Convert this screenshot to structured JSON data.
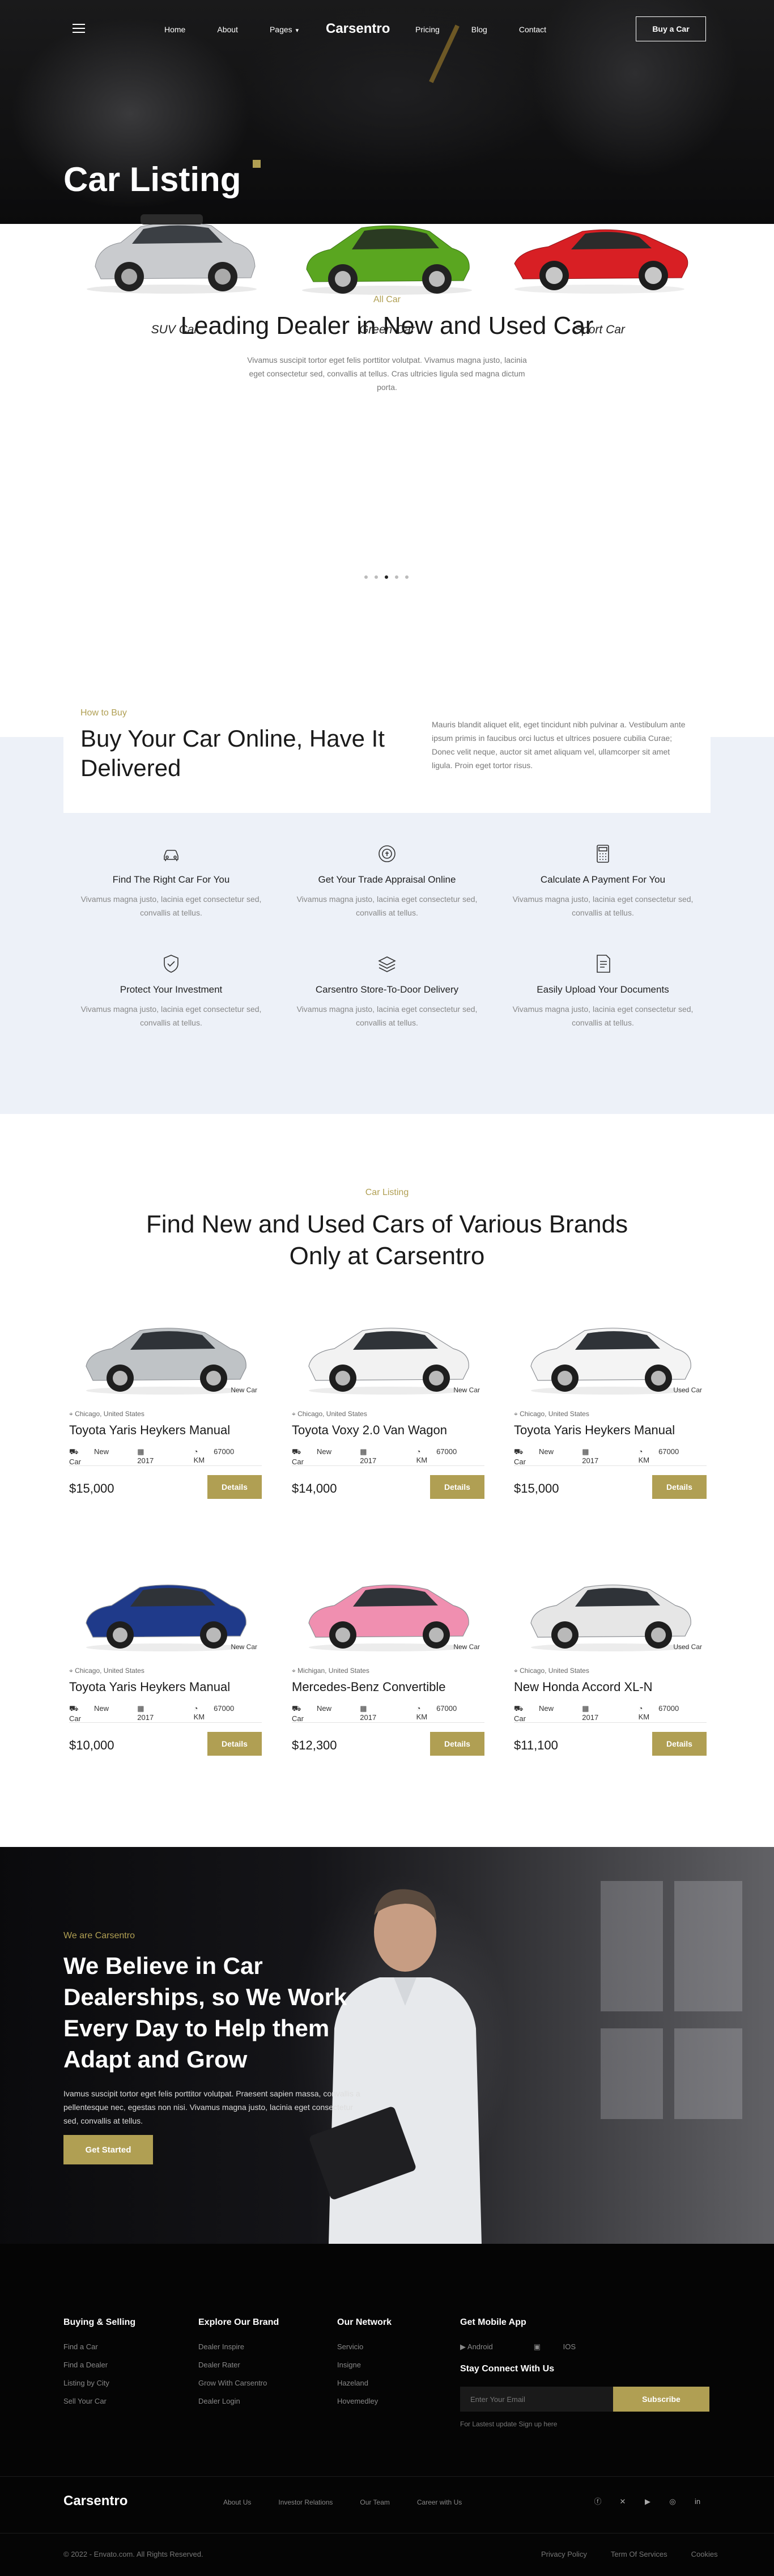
{
  "nav": {
    "items_left": [
      "Home",
      "About",
      "Pages"
    ],
    "logo": "Carsentro",
    "items_right": [
      "Pricing",
      "Blog",
      "Contact"
    ],
    "cta": "Buy a Car"
  },
  "hero": {
    "title": "Car Listing"
  },
  "lead": {
    "kicker": "All Car",
    "title": "Leading Dealer in New and Used Car",
    "subtitle": "Vivamus suscipit tortor eget felis porttitor volutpat. Vivamus magna justo, lacinia eget consectetur sed, convallis at tellus. Cras ultricies ligula sed magna dictum porta.",
    "categories": [
      "SUV Car",
      "Green Car",
      "Sport Car"
    ]
  },
  "how": {
    "kicker": "How to Buy",
    "title": "Buy Your Car Online, Have It Delivered",
    "text": "Mauris blandit aliquet elit, eget tincidunt nibh pulvinar a. Vestibulum ante ipsum primis in faucibus orci luctus et ultrices posuere cubilia Curae; Donec velit neque, auctor sit amet aliquam vel, ullamcorper sit amet ligula. Proin eget tortor risus.",
    "features": [
      {
        "title": "Find The Right Car For You",
        "text": "Vivamus magna justo, lacinia eget consectetur sed, convallis at tellus.",
        "icon": "car-icon"
      },
      {
        "title": "Get Your Trade Appraisal Online",
        "text": "Vivamus magna justo, lacinia eget consectetur sed, convallis at tellus.",
        "icon": "appraisal-icon"
      },
      {
        "title": "Calculate A Payment For You",
        "text": "Vivamus magna justo, lacinia eget consectetur sed, convallis at tellus.",
        "icon": "calculator-icon"
      },
      {
        "title": "Protect Your Investment",
        "text": "Vivamus magna justo, lacinia eget consectetur sed, convallis at tellus.",
        "icon": "shield-check-icon"
      },
      {
        "title": "Carsentro Store-To-Door Delivery",
        "text": "Vivamus magna justo, lacinia eget consectetur sed, convallis at tellus.",
        "icon": "layers-icon"
      },
      {
        "title": "Easily Upload Your Documents",
        "text": "Vivamus magna justo, lacinia eget consectetur sed, convallis at tellus.",
        "icon": "document-icon"
      }
    ]
  },
  "listing": {
    "kicker": "Car Listing",
    "title_line1": "Find New and Used Cars of Various Brands",
    "title_line2": "Only at Carsentro",
    "details_label": "Details",
    "cars": [
      {
        "badge": "New Car",
        "location": "Chicago, United States",
        "name": "Toyota Yaris Heykers Manual",
        "condition": "New Car",
        "year": "2017",
        "km": "67000 KM",
        "price": "$15,000",
        "color": "#bfc3c6"
      },
      {
        "badge": "New Car",
        "location": "Chicago, United States",
        "name": "Toyota Voxy 2.0 Van Wagon",
        "condition": "New Car",
        "year": "2017",
        "km": "67000 KM",
        "price": "$14,000",
        "color": "#f2f2f2"
      },
      {
        "badge": "Used Car",
        "location": "Chicago, United States",
        "name": "Toyota Yaris Heykers Manual",
        "condition": "New Car",
        "year": "2017",
        "km": "67000 KM",
        "price": "$15,000",
        "color": "#f4f4f4"
      },
      {
        "badge": "New Car",
        "location": "Chicago, United States",
        "name": "Toyota Yaris Heykers Manual",
        "condition": "New Car",
        "year": "2017",
        "km": "67000 KM",
        "price": "$10,000",
        "color": "#1f3a8a"
      },
      {
        "badge": "New Car",
        "location": "Michigan, United States",
        "name": "Mercedes-Benz Convertible",
        "condition": "New Car",
        "year": "2017",
        "km": "67000 KM",
        "price": "$12,300",
        "color": "#f08fb0"
      },
      {
        "badge": "Used Car",
        "location": "Chicago, United States",
        "name": "New Honda Accord XL-N",
        "condition": "New Car",
        "year": "2017",
        "km": "67000 KM",
        "price": "$11,100",
        "color": "#e6e6e6"
      }
    ]
  },
  "believe": {
    "kicker": "We are Carsentro",
    "title": "We Believe in Car Dealerships, so We Work Every Day to Help them Adapt and Grow",
    "text": "Ivamus suscipit tortor eget felis porttitor volutpat. Praesent sapien massa, convallis a pellentesque nec, egestas non nisi. Vivamus magna justo, lacinia eget consectetur sed, convallis at tellus.",
    "cta": "Get Started"
  },
  "footer": {
    "col1": {
      "title": "Buying & Selling",
      "items": [
        "Find a Car",
        "Find a Dealer",
        "Listing by City",
        "Sell Your Car"
      ]
    },
    "col2": {
      "title": "Explore Our Brand",
      "items": [
        "Dealer Inspire",
        "Dealer Rater",
        "Grow With Carsentro",
        "Dealer Login"
      ]
    },
    "col3": {
      "title": "Our Network",
      "items": [
        "Servicio",
        "Insigne",
        "Hazeland",
        "Hovemedley"
      ]
    },
    "app": {
      "title": "Get Mobile App",
      "android": "Android",
      "ios": "IOS"
    },
    "newsletter": {
      "title": "Stay Connect With Us",
      "placeholder": "Enter Your Email",
      "button": "Subscribe",
      "note": "For Lastest update Sign up here"
    },
    "logo": "Carsentro",
    "links": [
      "About Us",
      "Investor Relations",
      "Our Team",
      "Career with Us"
    ],
    "social": [
      "facebook-icon",
      "twitter-icon",
      "youtube-icon",
      "instagram-icon",
      "linkedin-icon"
    ],
    "copyright": "© 2022 - Envato.com. All Rights Reserved.",
    "legal": [
      "Privacy Policy",
      "Term Of Services",
      "Cookies"
    ]
  },
  "colors": {
    "accent": "#b09f53",
    "dark": "#050505",
    "light_bg": "#edf1f8"
  }
}
